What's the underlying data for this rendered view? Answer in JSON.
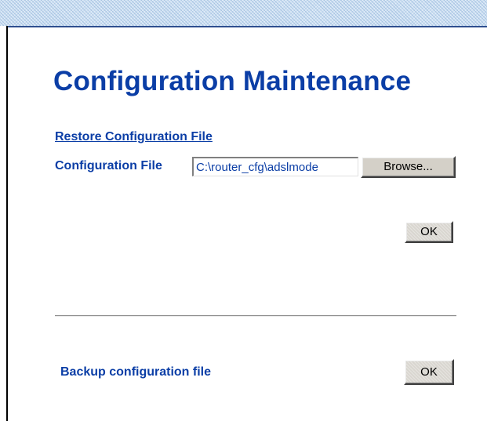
{
  "page": {
    "title": "Configuration Maintenance"
  },
  "restore": {
    "section_link": "Restore Configuration File",
    "field_label": "Configuration File",
    "file_value": "C:\\router_cfg\\adslmode",
    "browse_label": "Browse...",
    "ok_label": "OK"
  },
  "backup": {
    "label": "Backup configuration file",
    "ok_label": "OK"
  },
  "colors": {
    "heading": "#0b3ea6",
    "button_face": "#d4d0c8",
    "top_bar": "#cde0f3"
  }
}
